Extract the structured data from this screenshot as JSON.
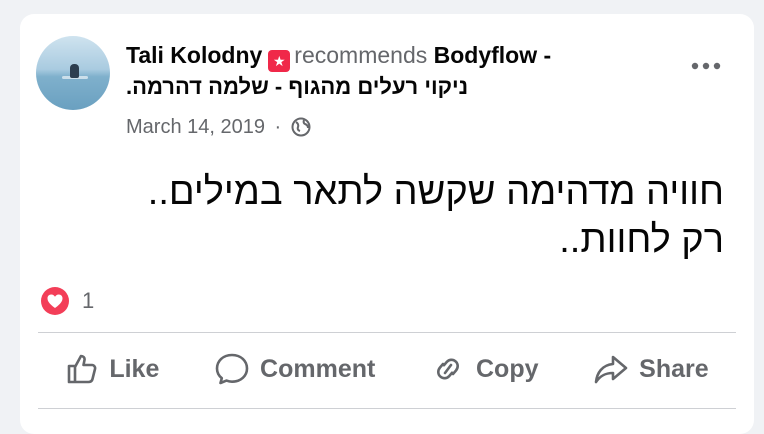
{
  "post": {
    "author": "Tali Kolodny",
    "recommends_text": "recommends",
    "page_name_part1": "Bodyflow -",
    "page_name_part2": "ניקוי רעלים מהגוף - שלמה דהרמה.",
    "date": "March 14, 2019",
    "separator": "·",
    "privacy_icon": "globe-icon",
    "body_line1": "חוויה מדהימה שקשה לתאר במילים..",
    "body_line2": "רק לחוות..",
    "reaction_icon": "love-reaction-icon",
    "reaction_count": "1"
  },
  "actions": {
    "like": "Like",
    "comment": "Comment",
    "copy": "Copy",
    "share": "Share"
  },
  "colors": {
    "recommend_icon": "#f02849",
    "love": "#f33e58",
    "muted_text": "#65676b"
  }
}
